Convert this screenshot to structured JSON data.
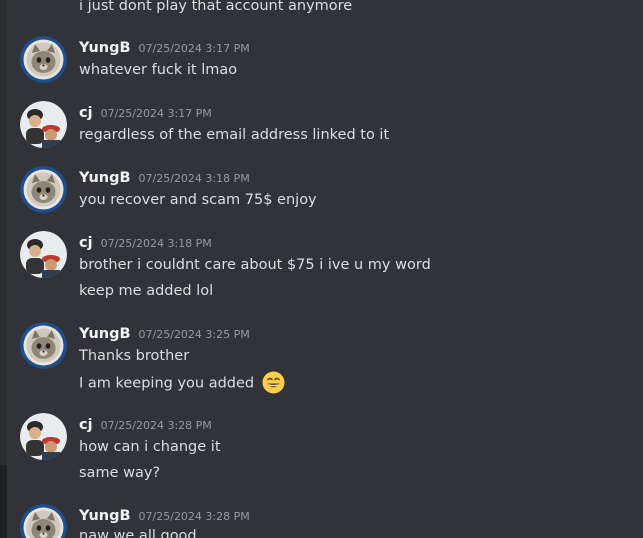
{
  "messages": [
    {
      "type": "continuation",
      "text": "i just dont play that account anymore"
    },
    {
      "type": "group",
      "author": "YungB",
      "timestamp": "07/25/2024 3:17 PM",
      "lines": [
        "whatever fuck it lmao"
      ]
    },
    {
      "type": "group",
      "author": "cj",
      "timestamp": "07/25/2024 3:17 PM",
      "lines": [
        "regardless of the email address linked to it"
      ]
    },
    {
      "type": "group",
      "author": "YungB",
      "timestamp": "07/25/2024 3:18 PM",
      "lines": [
        "you recover and scam 75$ enjoy"
      ]
    },
    {
      "type": "group",
      "author": "cj",
      "timestamp": "07/25/2024 3:18 PM",
      "lines": [
        "brother i couldnt care about $75 i ive u my word",
        "keep me added lol"
      ]
    },
    {
      "type": "group",
      "author": "YungB",
      "timestamp": "07/25/2024 3:25 PM",
      "lines": [
        "Thanks brother",
        "I am keeping you added"
      ],
      "emoji": "grinning-face-with-smiling-eyes"
    },
    {
      "type": "group",
      "author": "cj",
      "timestamp": "07/25/2024 3:28 PM",
      "lines": [
        "how can i change it",
        "same way?"
      ]
    },
    {
      "type": "group",
      "author": "YungB",
      "timestamp": "07/25/2024 3:28 PM",
      "lines": [
        "naw we all good"
      ]
    }
  ],
  "colors": {
    "background": "#313338",
    "username": "#f2f3f5",
    "message_text": "#dbdee1",
    "timestamp": "#949ba4"
  },
  "icons": {
    "yungb_avatar": "cat-avatar-icon",
    "cj_avatar": "person-avatar-icon",
    "emoji": "grinning-face-emoji-icon"
  }
}
